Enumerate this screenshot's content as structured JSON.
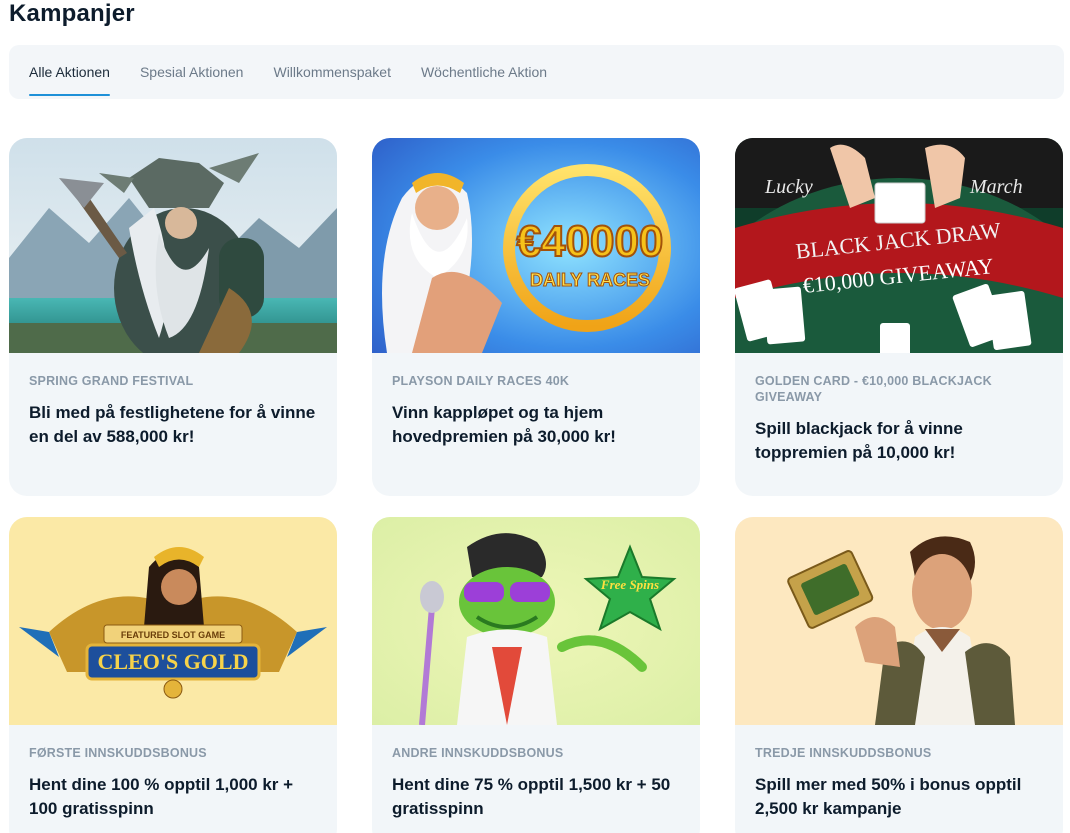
{
  "page": {
    "title": "Kampanjer"
  },
  "tabs": [
    {
      "label": "Alle Aktionen",
      "active": true
    },
    {
      "label": "Spesial Aktionen",
      "active": false
    },
    {
      "label": "Willkommenspaket",
      "active": false
    },
    {
      "label": "Wöchentliche Aktion",
      "active": false
    }
  ],
  "colors": {
    "accent": "#1e90d8",
    "card_bg": "#f2f6f9",
    "tab_bar_bg": "#f3f6f9"
  },
  "cards": [
    {
      "category": "SPRING GRAND FESTIVAL",
      "description": "Bli med på festlighetene for å vinne en del av 588,000 kr!",
      "image": "viking-warrior-illustration"
    },
    {
      "category": "PLAYSON DAILY RACES 40K",
      "description": "Vinn kappløpet og ta hjem hovedpremien på 30,000 kr!",
      "image": "zeus-daily-races-illustration",
      "image_text": {
        "amount": "€40000",
        "sub": "DAILY RACES"
      }
    },
    {
      "category": "GOLDEN CARD - €10,000 BLACKJACK GIVEAWAY",
      "description": "Spill blackjack for å vinne toppremien på 10,000 kr!",
      "image": "blackjack-table-illustration",
      "image_text": {
        "left": "Lucky",
        "right": "March",
        "line1": "BLACK JACK DRAW",
        "line2": "€10,000 GIVEAWAY"
      }
    },
    {
      "category": "FØRSTE INNSKUDDSBONUS",
      "description": "Hent dine 100 % opptil 1,000 kr + 100 gratisspinn",
      "image": "cleos-gold-illustration",
      "image_text": {
        "featured": "FEATURED SLOT GAME",
        "logo": "CLEO'S GOLD"
      }
    },
    {
      "category": "ANDRE INNSKUDDSBONUS",
      "description": "Hent dine 75 % opptil 1,500 kr + 50 gratisspinn",
      "image": "frog-singer-illustration",
      "image_text": {
        "badge": "Free Spins"
      }
    },
    {
      "category": "TREDJE INNSKUDDSBONUS",
      "description": "Spill mer med 50% i bonus opptil 2,500 kr kampanje",
      "image": "adventurer-illustration"
    }
  ]
}
